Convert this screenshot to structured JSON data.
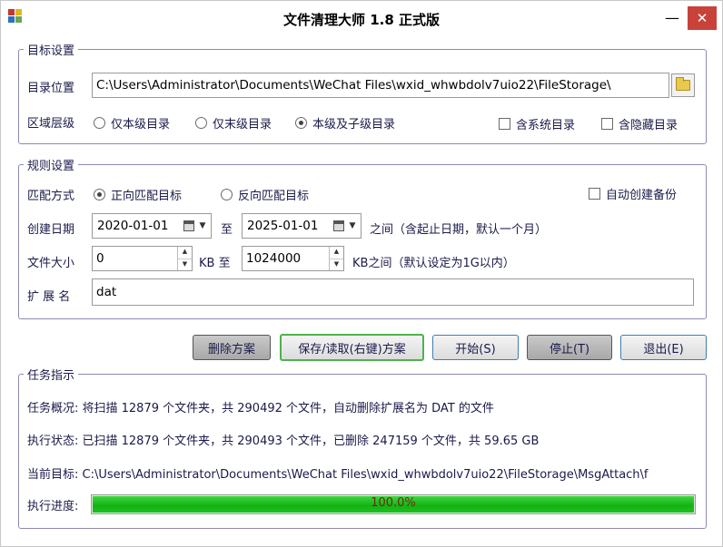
{
  "window": {
    "title": "文件清理大师 1.8 正式版",
    "minimize_glyph": "—",
    "close_glyph": "✕"
  },
  "target": {
    "legend": "目标设置",
    "dir_label": "目录位置",
    "dir_value": "C:\\Users\\Administrator\\Documents\\WeChat Files\\wxid_whwbdolv7uio22\\FileStorage\\",
    "scope_label": "区域层级",
    "scope_options": [
      "仅本级目录",
      "仅末级目录",
      "本级及子级目录"
    ],
    "scope_selected": 2,
    "include_system": "含系统目录",
    "include_hidden": "含隐藏目录"
  },
  "rules": {
    "legend": "规则设置",
    "match_label": "匹配方式",
    "match_options": [
      "正向匹配目标",
      "反向匹配目标"
    ],
    "match_selected": 0,
    "auto_backup": "自动创建备份",
    "date_label": "创建日期",
    "date_from": "2020-01-01",
    "date_to_word": "至",
    "date_to": "2025-01-01",
    "date_note": "之间（含起止日期，默认一个月）",
    "size_label": "文件大小",
    "size_from": "0",
    "size_kb_to": "KB 至",
    "size_to": "1024000",
    "size_note": "KB之间（默认设定为1G以内）",
    "ext_label": "扩 展 名",
    "ext_value": "dat"
  },
  "buttons": {
    "delete_scheme": "删除方案",
    "save_load": "保存/读取(右键)方案",
    "start": "开始(S)",
    "stop": "停止(T)",
    "exit": "退出(E)"
  },
  "task": {
    "legend": "任务指示",
    "overview": "任务概况: 将扫描 12879 个文件夹，共 290492 个文件，自动删除扩展名为 DAT 的文件",
    "status": "执行状态: 已扫描 12879 个文件夹，共 290493 个文件，已删除 247159 个文件，共 59.65 GB",
    "current": "当前目标: C:\\Users\\Administrator\\Documents\\WeChat Files\\wxid_whwbdolv7uio22\\FileStorage\\MsgAttach\\f",
    "progress_label": "执行进度:",
    "progress_text": "100.0%",
    "progress_fraction": 1.0
  },
  "colors": {
    "progress_green": "#12b212",
    "close_red": "#c9423a",
    "text_navy": "#1a1a4a"
  }
}
